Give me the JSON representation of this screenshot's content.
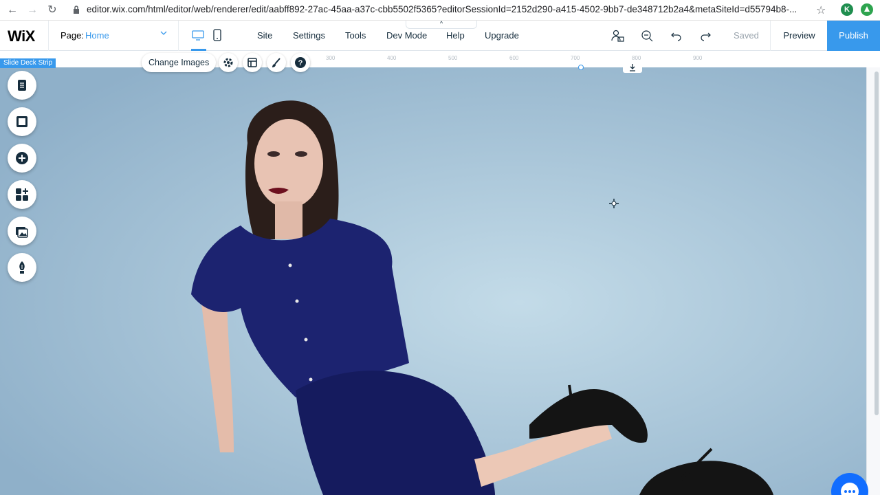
{
  "browser": {
    "url": "editor.wix.com/html/editor/web/renderer/edit/aabff892-27ac-45aa-a37c-cbb5502f5365?editorSessionId=2152d290-a415-4502-9bb7-de348712b2a4&metaSiteId=d55794b8-...",
    "avatar_letter": "K",
    "icons": [
      "back-icon",
      "forward-icon",
      "reload-icon",
      "lock-icon",
      "star-icon",
      "extension-icon"
    ]
  },
  "topbar": {
    "logo": "WiX",
    "page_label": "Page:",
    "page_value": "Home",
    "menu": [
      "Site",
      "Settings",
      "Tools",
      "Dev Mode",
      "Help",
      "Upgrade"
    ],
    "saved": "Saved",
    "preview": "Preview",
    "publish": "Publish",
    "collapse_icon": "^"
  },
  "canvas": {
    "strip_badge": "Slide Deck Strip",
    "change_images": "Change Images",
    "ruler_ticks": [
      "300",
      "400",
      "500",
      "600",
      "700",
      "800",
      "900"
    ]
  },
  "colors": {
    "accent": "#3899ec",
    "publish_bg": "#3899ec",
    "chat_bg": "#116dff",
    "dress": "#1c2370",
    "backdrop": "#a7c4d8"
  }
}
